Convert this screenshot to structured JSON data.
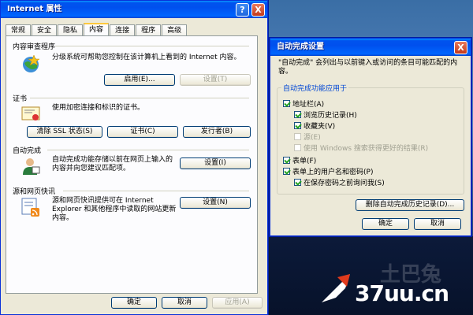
{
  "main_dialog": {
    "title": "Internet 属性",
    "help_btn": "?",
    "close_btn": "X",
    "tabs": [
      "常规",
      "安全",
      "隐私",
      "内容",
      "连接",
      "程序",
      "高级"
    ],
    "content_advisor": {
      "label": "内容审查程序",
      "desc": "分级系统可帮助您控制在该计算机上看到的 Internet 内容。",
      "enable_btn": "启用(E)...",
      "settings_btn": "设置(T)"
    },
    "certificates": {
      "label": "证书",
      "desc": "使用加密连接和标识的证书。",
      "clear_ssl_btn": "清除 SSL 状态(S)",
      "certs_btn": "证书(C)",
      "publishers_btn": "发行者(B)"
    },
    "autocomplete": {
      "label": "自动完成",
      "desc": "自动完成功能存储以前在网页上输入的内容并向您建议匹配项。",
      "settings_btn": "设置(I)"
    },
    "feeds": {
      "label": "源和网页快讯",
      "desc": "源和网页快讯提供可在 Internet Explorer 和其他程序中读取的网站更新内容。",
      "settings_btn": "设置(N)"
    },
    "ok_btn": "确定",
    "cancel_btn": "取消",
    "apply_btn": "应用(A)"
  },
  "autocomplete_dialog": {
    "title": "自动完成设置",
    "close_btn": "X",
    "intro": "\"自动完成\" 会列出与以前键入或访问的条目可能匹配的内容。",
    "group_label": "自动完成功能应用于",
    "options": [
      {
        "label": "地址栏(A)",
        "checked": true,
        "disabled": false
      },
      {
        "label": "浏览历史记录(H)",
        "checked": true,
        "disabled": false
      },
      {
        "label": "收藏夹(V)",
        "checked": true,
        "disabled": false
      },
      {
        "label": "源(E)",
        "checked": false,
        "disabled": true
      },
      {
        "label": "使用 Windows 搜索获得更好的结果(R)",
        "checked": false,
        "disabled": true
      },
      {
        "label": "表单(F)",
        "checked": true,
        "disabled": false
      },
      {
        "label": "表单上的用户名和密码(P)",
        "checked": true,
        "disabled": false
      },
      {
        "label": "在保存密码之前询问我(S)",
        "checked": true,
        "disabled": false
      }
    ],
    "delete_history_btn": "删除自动完成历史记录(D)...",
    "ok_btn": "确定",
    "cancel_btn": "取消"
  },
  "watermark": {
    "chinese": "土巴兔",
    "site": "37uu.cn"
  },
  "colors": {
    "titlebar": "#0053ee",
    "dialog_bg": "#ece9d8",
    "group_label": "#0046d5"
  }
}
